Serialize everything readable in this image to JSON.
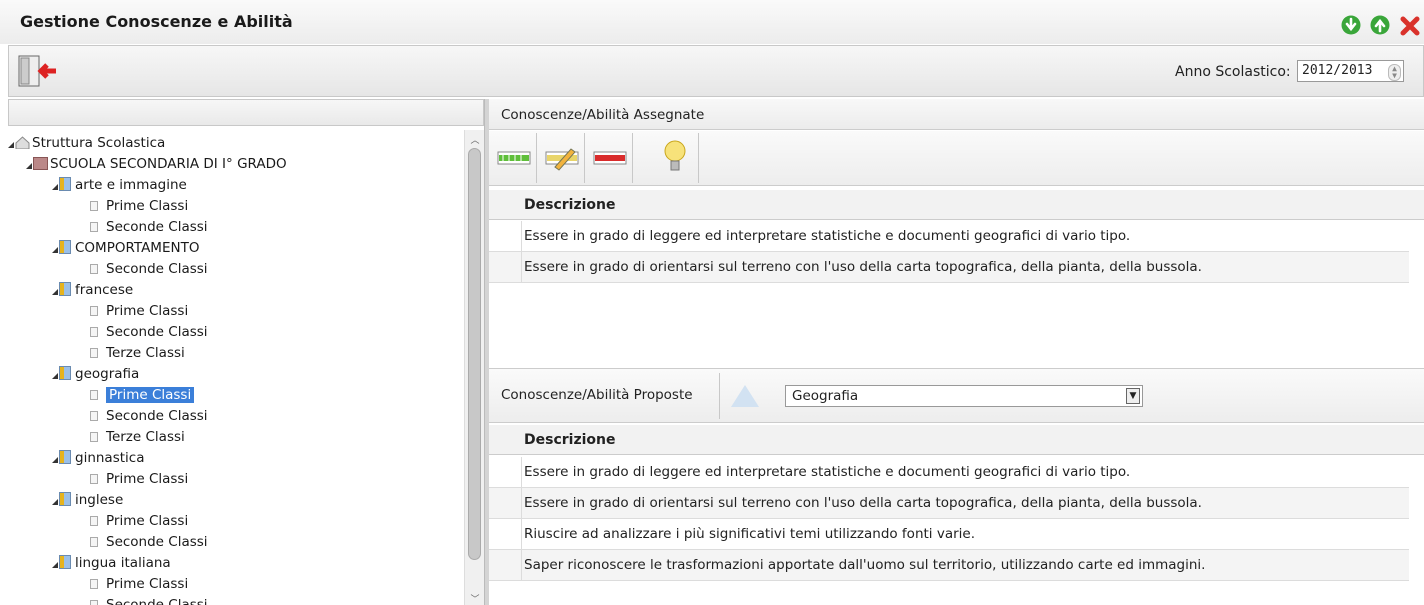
{
  "window": {
    "title": "Gestione Conoscenze e Abilità"
  },
  "toolbar": {
    "anno_label": "Anno Scolastico:",
    "anno_value": "2012/2013"
  },
  "tree": {
    "root": "Struttura Scolastica",
    "school": "SCUOLA SECONDARIA DI I° GRADO",
    "subjects": [
      {
        "name": "arte e immagine",
        "classes": [
          "Prime Classi",
          "Seconde Classi"
        ]
      },
      {
        "name": "COMPORTAMENTO",
        "classes": [
          "Seconde Classi"
        ]
      },
      {
        "name": "francese",
        "classes": [
          "Prime Classi",
          "Seconde Classi",
          "Terze Classi"
        ]
      },
      {
        "name": "geografia",
        "classes": [
          "Prime Classi",
          "Seconde Classi",
          "Terze Classi"
        ]
      },
      {
        "name": "ginnastica",
        "classes": [
          "Prime Classi"
        ]
      },
      {
        "name": "inglese",
        "classes": [
          "Prime Classi",
          "Seconde Classi"
        ]
      },
      {
        "name": "lingua italiana",
        "classes": [
          "Prime Classi",
          "Seconde Classi"
        ]
      }
    ],
    "selected": "geografia / Prime Classi"
  },
  "assigned": {
    "title": "Conoscenze/Abilità Assegnate",
    "column": "Descrizione",
    "rows": [
      "Essere in grado di leggere ed interpretare statistiche e documenti geografici di vario tipo.",
      "Essere in grado di orientarsi sul terreno con l'uso della carta topografica, della pianta, della bussola."
    ]
  },
  "proposed": {
    "title": "Conoscenze/Abilità Proposte",
    "select_value": "Geografia",
    "column": "Descrizione",
    "rows": [
      "Essere in grado di leggere ed interpretare statistiche e documenti geografici di vario tipo.",
      "Essere in grado di orientarsi sul terreno con l'uso della carta topografica, della pianta, della bussola.",
      "Riuscire ad analizzare i più significativi temi utilizzando fonti varie.",
      "Saper riconoscere le trasformazioni apportate dall'uomo sul territorio, utilizzando carte ed immagini."
    ]
  },
  "icons": {
    "window": [
      "download-icon",
      "upload-icon",
      "close-icon"
    ],
    "exit": "exit-door-icon",
    "assigned_toolbar": [
      "add-row-icon",
      "edit-row-icon",
      "delete-row-icon",
      "lightbulb-icon"
    ],
    "move_up": "triangle-up-icon"
  },
  "colors": {
    "selection": "#3b7fd9",
    "green_button": "#3aa63a",
    "close_red": "#d9322b"
  }
}
